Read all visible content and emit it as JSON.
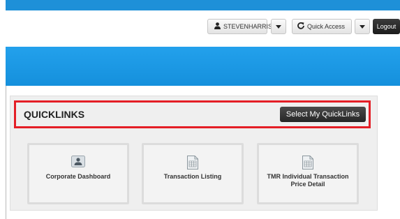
{
  "header": {
    "user_label": "STEVENHARRIS",
    "quick_access_label": "Quick Access",
    "logout_label": "Logout"
  },
  "quicklinks": {
    "title": "QUICKLINKS",
    "select_label": "Select My QuickLinks",
    "tiles": [
      {
        "label": "Corporate Dashboard",
        "icon": "profile-card-icon"
      },
      {
        "label": "Transaction Listing",
        "icon": "document-table-icon"
      },
      {
        "label": "TMR Individual Transaction Price Detail",
        "icon": "document-table-icon"
      }
    ]
  },
  "colors": {
    "accent_blue": "#1e90d8",
    "highlight_red": "#e41e26",
    "dark_button": "#262626"
  }
}
